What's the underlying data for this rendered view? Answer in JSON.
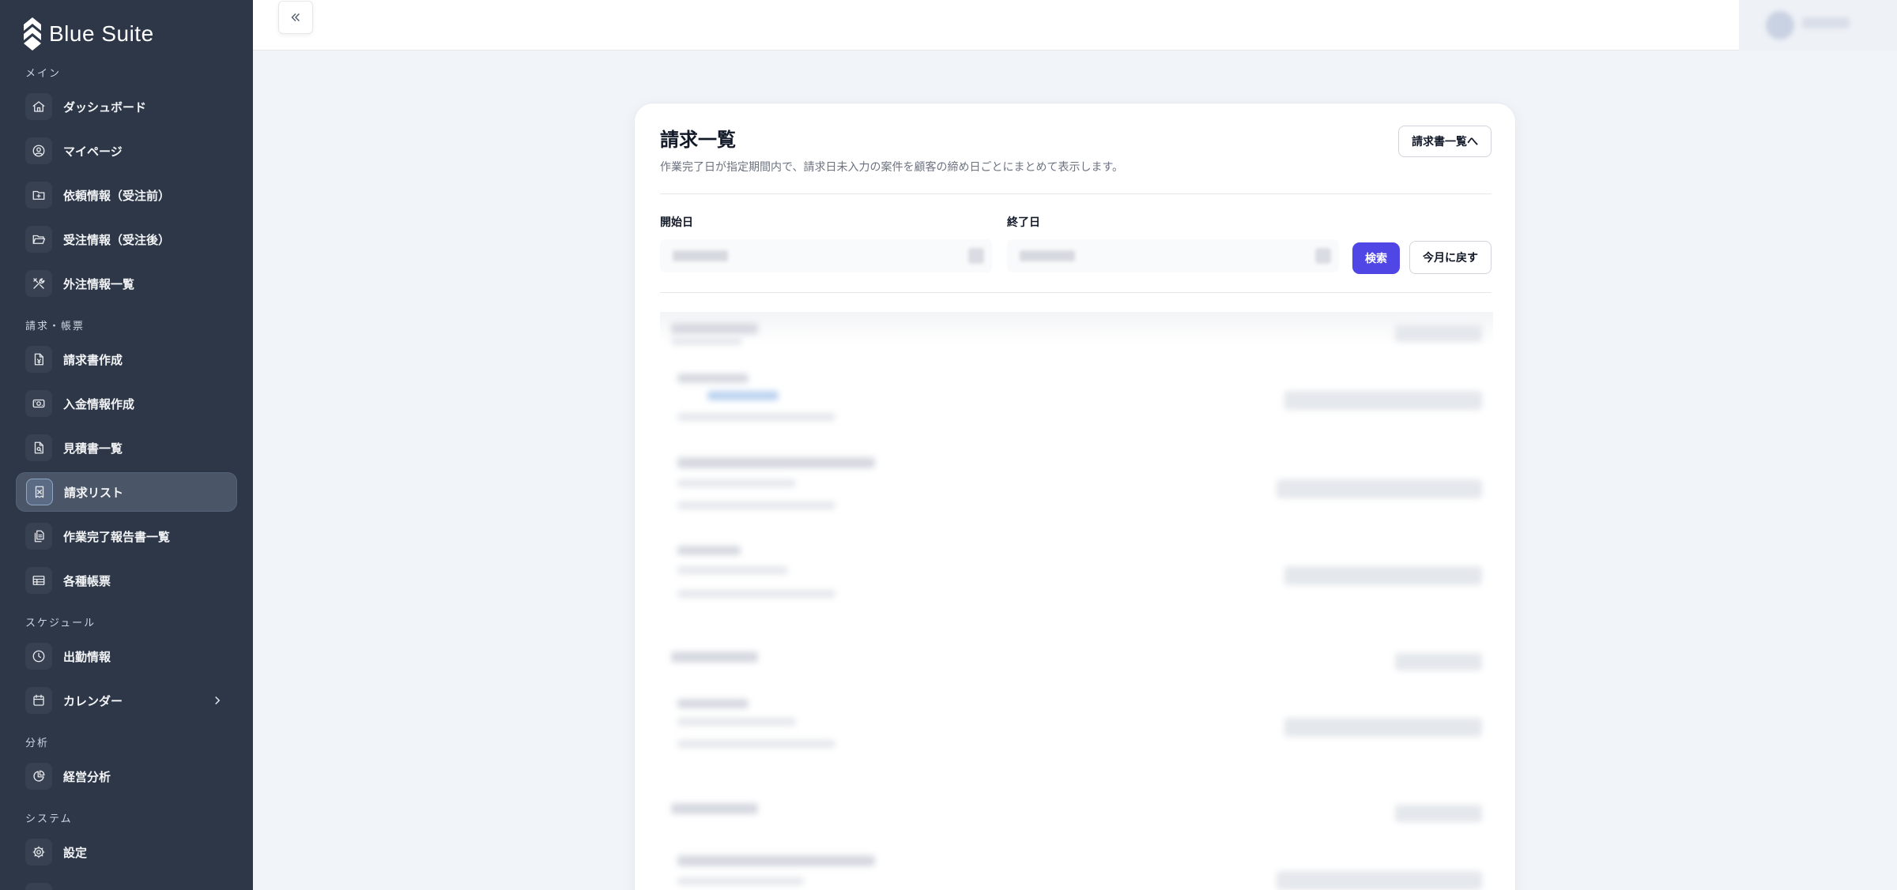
{
  "app": {
    "name": "Blue Suite"
  },
  "sidebar": {
    "sections": [
      {
        "label": "メイン",
        "items": [
          {
            "label": "ダッシュボード",
            "icon": "home-icon"
          },
          {
            "label": "マイページ",
            "icon": "user-circle-icon"
          },
          {
            "label": "依頼情報（受注前）",
            "icon": "folder-plus-icon"
          },
          {
            "label": "受注情報（受注後）",
            "icon": "folder-open-icon"
          },
          {
            "label": "外注情報一覧",
            "icon": "tools-icon"
          }
        ]
      },
      {
        "label": "請求・帳票",
        "items": [
          {
            "label": "請求書作成",
            "icon": "file-yen-icon"
          },
          {
            "label": "入金情報作成",
            "icon": "money-icon"
          },
          {
            "label": "見積書一覧",
            "icon": "file-quote-icon"
          },
          {
            "label": "請求リスト",
            "icon": "receipt-icon",
            "active": true
          },
          {
            "label": "作業完了報告書一覧",
            "icon": "files-icon"
          },
          {
            "label": "各種帳票",
            "icon": "table-icon"
          }
        ]
      },
      {
        "label": "スケジュール",
        "items": [
          {
            "label": "出勤情報",
            "icon": "clock-icon"
          },
          {
            "label": "カレンダー",
            "icon": "calendar-icon"
          }
        ]
      },
      {
        "label": "分析",
        "items": [
          {
            "label": "経営分析",
            "icon": "pie-chart-icon"
          }
        ]
      },
      {
        "label": "システム",
        "items": [
          {
            "label": "設定",
            "icon": "gear-icon"
          }
        ]
      }
    ]
  },
  "page": {
    "title": "請求一覧",
    "description": "作業完了日が指定期間内で、請求日未入力の案件を顧客の締め日ごとにまとめて表示します。",
    "to_invoice_list_label": "請求書一覧へ",
    "start_date_label": "開始日",
    "end_date_label": "終了日",
    "search_label": "検索",
    "reset_label": "今月に戻す"
  },
  "colors": {
    "sidebar_bg": "#2d3748",
    "accent": "#4f46e5",
    "page_bg": "#f1f4f8"
  }
}
